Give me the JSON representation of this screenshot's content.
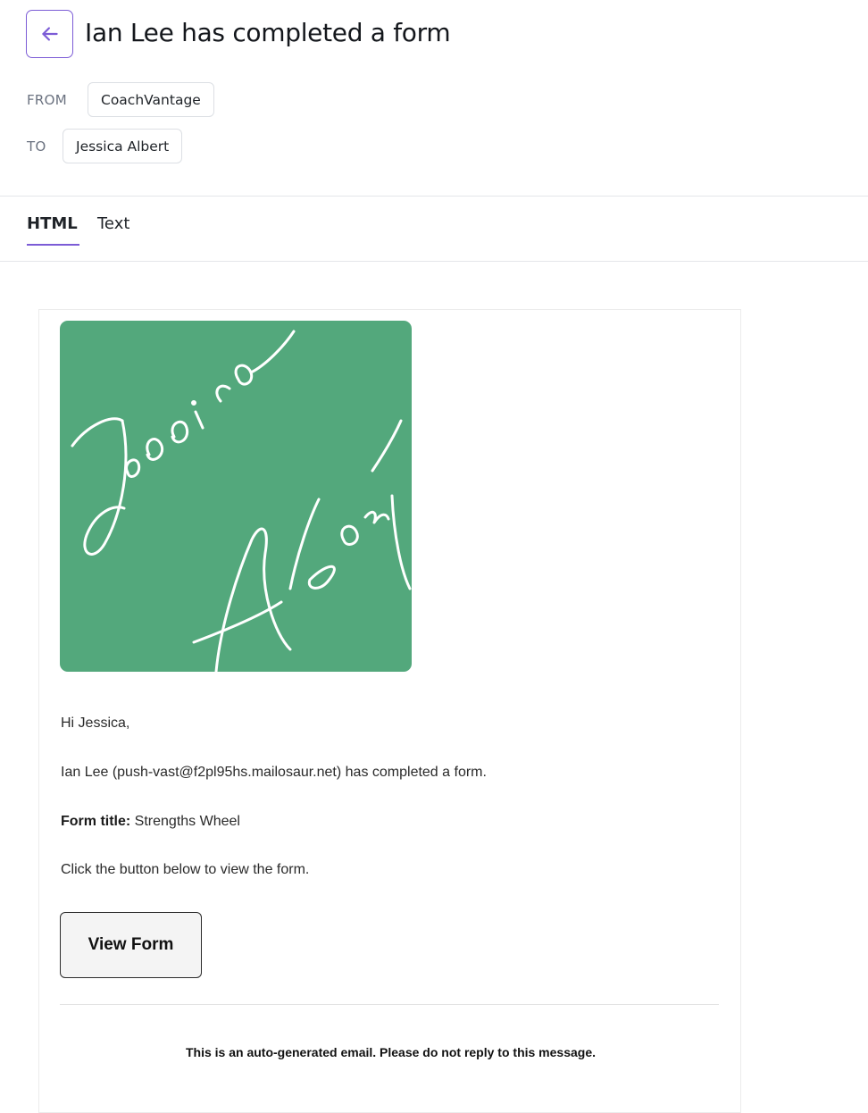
{
  "header": {
    "subject": "Ian Lee has completed a form",
    "from_label": "FROM",
    "from_value": "CoachVantage",
    "to_label": "TO",
    "to_value": "Jessica Albert"
  },
  "tabs": [
    {
      "label": "HTML",
      "active": true
    },
    {
      "label": "Text",
      "active": false
    }
  ],
  "email": {
    "logo_text": "Jessica Albert",
    "logo_bg": "#53a87c",
    "greeting": "Hi Jessica,",
    "completed_line": "Ian Lee (push-vast@f2pl95hs.mailosaur.net) has completed a form.",
    "form_title_label": "Form title:",
    "form_title_value": "Strengths Wheel",
    "instruction": "Click the button below to view the form.",
    "button_label": "View Form",
    "footer": "This is an auto-generated email. Please do not reply to this message."
  },
  "colors": {
    "accent": "#7c5cd6"
  }
}
